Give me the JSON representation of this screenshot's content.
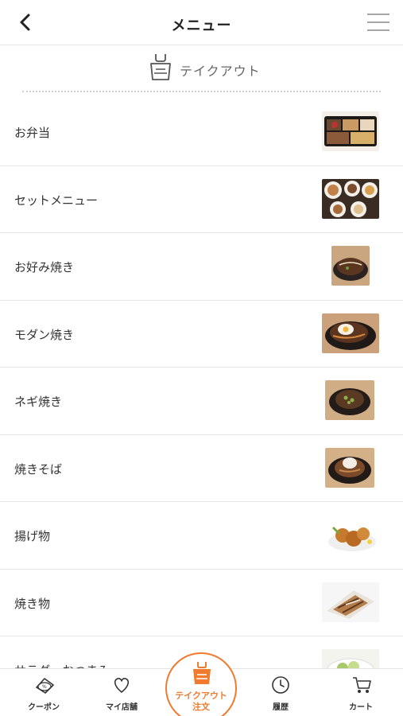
{
  "header": {
    "title": "メニュー",
    "back_icon": "chevron-left-icon",
    "menu_icon": "hamburger-menu-icon"
  },
  "section": {
    "label": "テイクアウト",
    "icon": "takeout-bag-icon"
  },
  "menu_items": [
    {
      "label": "お弁当",
      "thumb": "bento-photo"
    },
    {
      "label": "セットメニュー",
      "thumb": "set-menu-photo"
    },
    {
      "label": "お好み焼き",
      "thumb": "okonomiyaki-photo"
    },
    {
      "label": "モダン焼き",
      "thumb": "modanyaki-photo"
    },
    {
      "label": "ネギ焼き",
      "thumb": "negiyaki-photo"
    },
    {
      "label": "焼きそば",
      "thumb": "yakisoba-photo"
    },
    {
      "label": "揚げ物",
      "thumb": "fried-food-photo"
    },
    {
      "label": "焼き物",
      "thumb": "grilled-food-photo"
    },
    {
      "label": "サラダ・おつまみ",
      "thumb": "salad-photo"
    }
  ],
  "tabbar": {
    "coupon": "クーポン",
    "my_store": "マイ店舗",
    "takeout_line1": "テイクアウト",
    "takeout_line2": "注文",
    "history": "履歴",
    "cart": "カート"
  },
  "colors": {
    "accent": "#f07a2e",
    "divider": "#e6e6e6",
    "text": "#333333"
  }
}
